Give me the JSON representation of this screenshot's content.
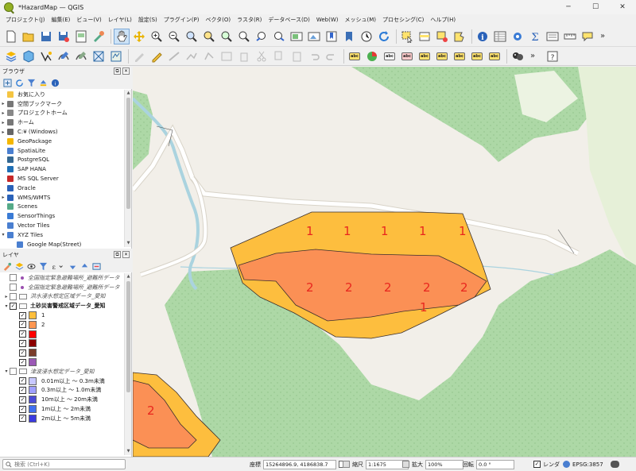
{
  "window": {
    "title": "*HazardMap — QGIS",
    "minimize": "─",
    "maximize": "☐",
    "close": "✕"
  },
  "menu": [
    "プロジェクト(J)",
    "編集(E)",
    "ビュー(V)",
    "レイヤ(L)",
    "設定(S)",
    "プラグイン(P)",
    "ベクタ(O)",
    "ラスタ(R)",
    "データベース(D)",
    "Web(W)",
    "メッシュ(M)",
    "プロセシング(C)",
    "ヘルプ(H)"
  ],
  "toolbar_more": "»",
  "browser_panel": {
    "title": "ブラウザ",
    "items": [
      {
        "label": "お気に入り",
        "icon": "star-icon",
        "caret": ""
      },
      {
        "label": "空間ブックマーク",
        "icon": "bookmark-icon",
        "caret": "▸"
      },
      {
        "label": "プロジェクトホーム",
        "icon": "project-home-icon",
        "caret": "▸"
      },
      {
        "label": "ホーム",
        "icon": "home-folder-icon",
        "caret": "▸"
      },
      {
        "label": "C:¥ (Windows)",
        "icon": "drive-icon",
        "caret": "▸"
      },
      {
        "label": "GeoPackage",
        "icon": "geopackage-icon",
        "caret": ""
      },
      {
        "label": "SpatiaLite",
        "icon": "spatialite-icon",
        "caret": ""
      },
      {
        "label": "PostgreSQL",
        "icon": "postgresql-icon",
        "caret": ""
      },
      {
        "label": "SAP HANA",
        "icon": "sap-hana-icon",
        "caret": ""
      },
      {
        "label": "MS SQL Server",
        "icon": "mssql-icon",
        "caret": ""
      },
      {
        "label": "Oracle",
        "icon": "oracle-icon",
        "caret": ""
      },
      {
        "label": "WMS/WMTS",
        "icon": "wms-icon",
        "caret": "▸"
      },
      {
        "label": "Scenes",
        "icon": "scenes-icon",
        "caret": ""
      },
      {
        "label": "SensorThings",
        "icon": "sensorthings-icon",
        "caret": ""
      },
      {
        "label": "Vector Tiles",
        "icon": "vector-tiles-icon",
        "caret": ""
      },
      {
        "label": "XYZ Tiles",
        "icon": "xyz-tiles-icon",
        "caret": "▾"
      },
      {
        "label": "Google Map(Street)",
        "icon": "xyz-layer-icon",
        "caret": ""
      }
    ]
  },
  "layers_panel": {
    "title": "レイヤ",
    "rows": [
      {
        "kind": "point",
        "label": "全国指定緊急避難場所_避難所データ",
        "checked": false,
        "italic": true
      },
      {
        "kind": "point",
        "label": "全国指定緊急避難場所_避難所データ",
        "checked": false,
        "italic": true
      },
      {
        "kind": "group",
        "label": "洪水浸水想定区域データ_愛知",
        "checked": false,
        "italic": true,
        "caret": "▸"
      },
      {
        "kind": "group",
        "label": "土砂災害警戒区域データ_愛知",
        "checked": true,
        "bold": true,
        "caret": "▾"
      },
      {
        "kind": "class",
        "label": "1",
        "color": "#ffbe3c"
      },
      {
        "kind": "class",
        "label": "2",
        "color": "#ff9650"
      },
      {
        "kind": "class",
        "label": "",
        "color": "#ff0000"
      },
      {
        "kind": "class",
        "label": "",
        "color": "#8c0000"
      },
      {
        "kind": "class",
        "label": "",
        "color": "#7a3d2a"
      },
      {
        "kind": "class",
        "label": "",
        "color": "#9b59b6"
      },
      {
        "kind": "group",
        "label": "津波浸水想定データ_愛知",
        "checked": false,
        "italic": true,
        "caret": "▾"
      },
      {
        "kind": "class",
        "label": "0.01m以上 ～ 0.3m未満",
        "color": "#c8c8ff"
      },
      {
        "kind": "class",
        "label": "0.3m以上 ～ 1.0m未満",
        "color": "#a0a0ff"
      },
      {
        "kind": "class",
        "label": "10m以上 ～ 20m未満",
        "color": "#4b4bd6"
      },
      {
        "kind": "class",
        "label": "1m以上 ～ 2m未満",
        "color": "#3f6ff0"
      },
      {
        "kind": "class",
        "label": "2m以上 ～ 5m未満",
        "color": "#3a3ae0"
      }
    ]
  },
  "map": {
    "labels_class1": [
      "1",
      "1",
      "1",
      "1",
      "1",
      "1"
    ],
    "labels_class2": [
      "2",
      "2",
      "2",
      "2",
      "2"
    ],
    "label_partial": "2",
    "colors": {
      "background": "#f2efe9",
      "green": "#a8d5a0",
      "class1": "#fdbe3e",
      "class2": "#fb9055",
      "road": "#ffffff",
      "water": "#aad3df",
      "label": "#e8261e"
    }
  },
  "status": {
    "search_placeholder": "検索 (Ctrl+K)",
    "coordinate_label": "座標",
    "coordinate_value": "15264896.9, 4186838.7",
    "scale_label": "縮尺",
    "scale_value": "1:1675",
    "magnifier_label": "拡大",
    "magnifier_value": "100%",
    "rotation_label": "回転",
    "rotation_value": "0.0 °",
    "render_label": "レンダ",
    "crs": "EPSG:3857"
  }
}
